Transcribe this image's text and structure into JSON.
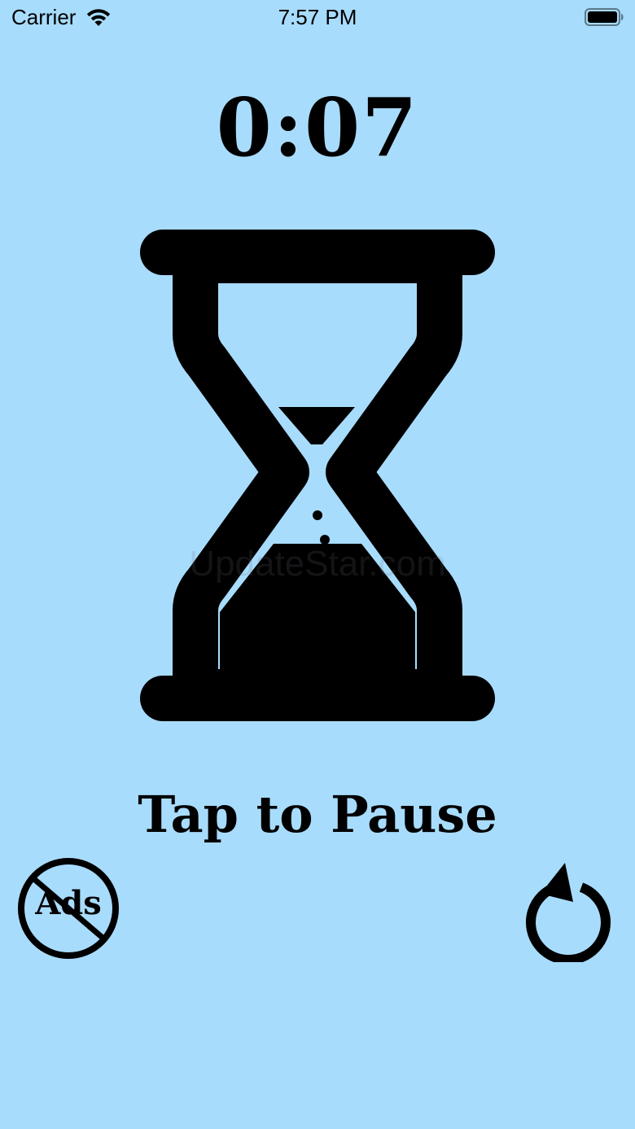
{
  "status_bar": {
    "carrier": "Carrier",
    "time": "7:57 PM",
    "wifi_icon": "wifi-icon",
    "battery_icon": "battery-icon"
  },
  "timer": {
    "elapsed": "0:07"
  },
  "hourglass": {
    "icon": "hourglass-icon",
    "top_sand_remaining": 0.15,
    "bottom_sand_filled": 0.85
  },
  "controls": {
    "tap_label": "Tap to Pause",
    "no_ads_label": "Ads",
    "no_ads_icon": "no-ads-icon",
    "reset_icon": "reset-icon"
  },
  "watermark": "UpdateStar.com",
  "colors": {
    "background": "#a8dcfc",
    "foreground": "#000000"
  }
}
